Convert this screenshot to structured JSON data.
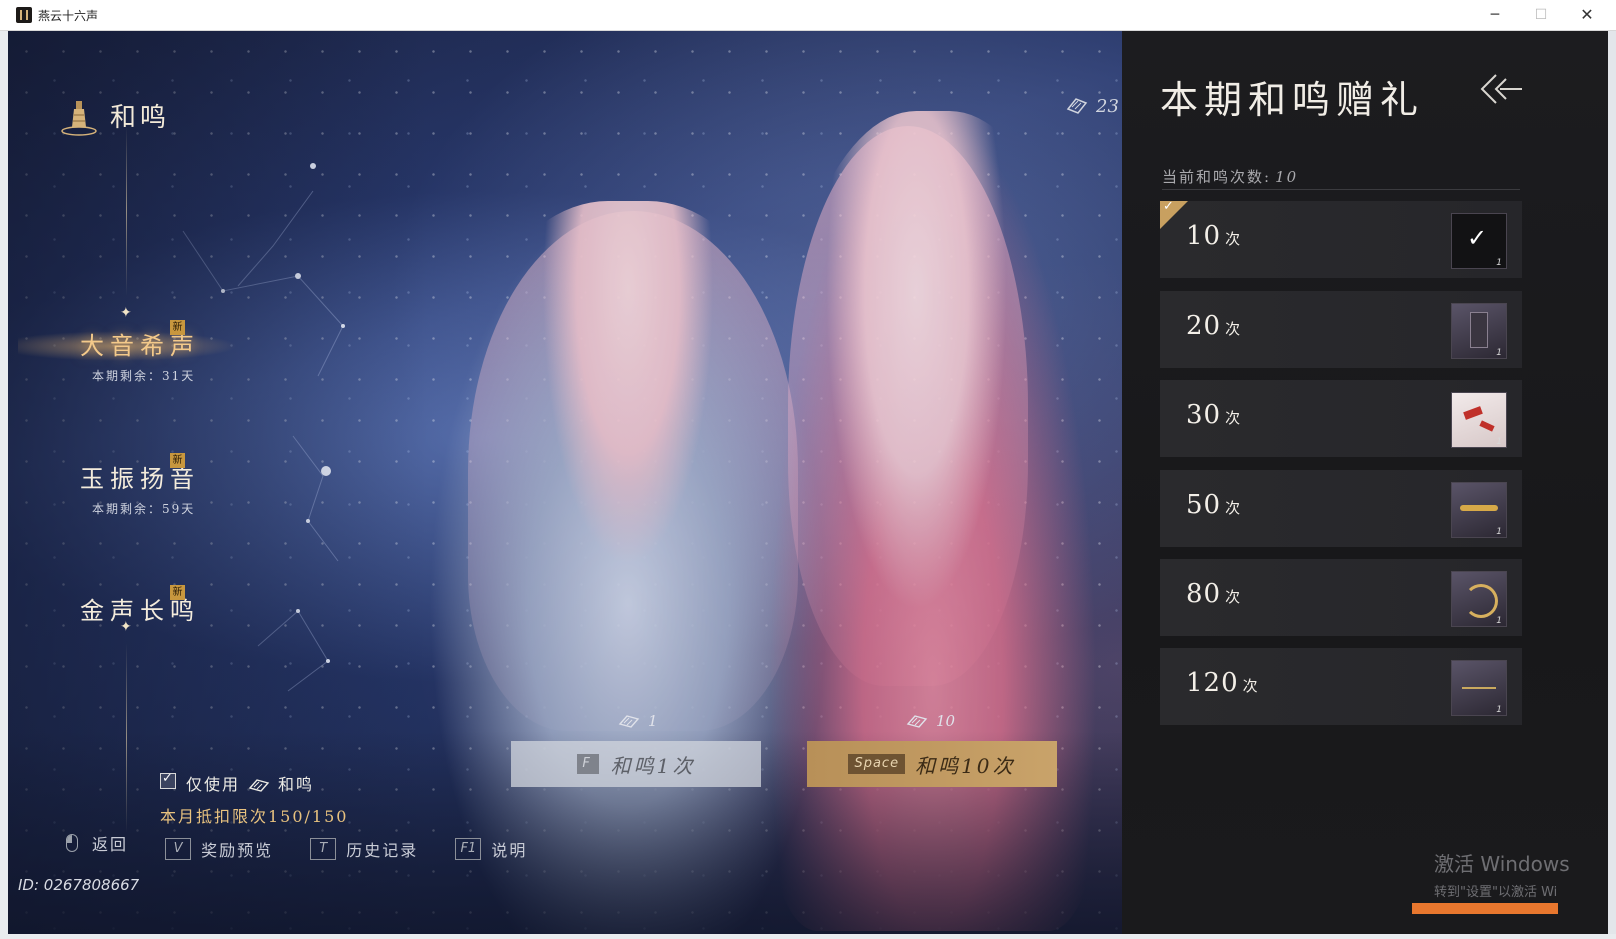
{
  "window": {
    "title": "燕云十六声",
    "minimize": "─",
    "maximize": "☐",
    "close": "✕"
  },
  "header": {
    "title": "和鸣"
  },
  "currency": {
    "amount": "23"
  },
  "events": [
    {
      "name": "大音希声",
      "badge": "新",
      "remaining": "本期剩余：31天",
      "active": true
    },
    {
      "name": "玉振扬音",
      "badge": "新",
      "remaining": "本期剩余：59天",
      "active": false
    },
    {
      "name": "金声长鸣",
      "badge": "新",
      "remaining": "",
      "active": false
    }
  ],
  "options": {
    "only_use_prefix": "仅使用",
    "only_use_suffix": "和鸣",
    "only_use_checked": true,
    "monthly_limit": "本月抵扣限次150/150"
  },
  "draw": {
    "single": {
      "cost": "1",
      "key": "F",
      "label": "和鸣1次"
    },
    "ten": {
      "cost": "10",
      "key": "Space",
      "label": "和鸣10次"
    }
  },
  "bottom_bar": {
    "back": "返回",
    "preview_key": "V",
    "preview": "奖励预览",
    "history_key": "T",
    "history": "历史记录",
    "help_key": "F1",
    "help": "说明"
  },
  "player": {
    "id": "ID: 0267808667"
  },
  "panel": {
    "title": "本期和鸣赠礼",
    "count_label": "当前和鸣次数:",
    "count_value": "10",
    "tiers": [
      {
        "num": "10",
        "unit": "次",
        "qty": "1",
        "claimed": true
      },
      {
        "num": "20",
        "unit": "次",
        "qty": "1",
        "claimed": false
      },
      {
        "num": "30",
        "unit": "次",
        "qty": "1",
        "claimed": false
      },
      {
        "num": "50",
        "unit": "次",
        "qty": "1",
        "claimed": false
      },
      {
        "num": "80",
        "unit": "次",
        "qty": "1",
        "claimed": false
      },
      {
        "num": "120",
        "unit": "次",
        "qty": "1",
        "claimed": false
      }
    ]
  },
  "watermark": {
    "line1": "激活 Windows",
    "line2": "转到\"设置\"以激活 Wi"
  },
  "colors": {
    "accent_gold": "#c8a060",
    "active_event": "#f3c98a",
    "panel_bg": "#1c1c1f"
  }
}
